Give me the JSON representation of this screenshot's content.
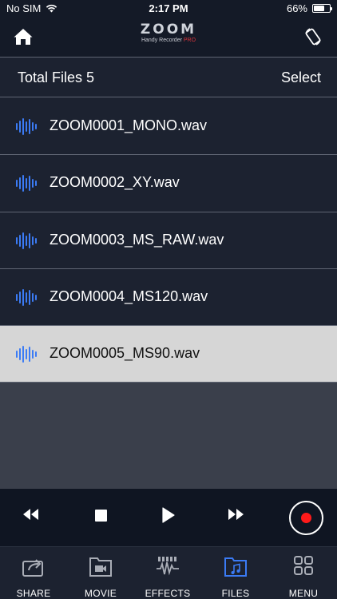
{
  "status_bar": {
    "carrier": "No SIM",
    "time": "2:17 PM",
    "battery_percent": "66%",
    "battery_level": 0.66,
    "icons": [
      "wifi-icon",
      "battery-icon"
    ]
  },
  "top_bar": {
    "logo": "ZOOM",
    "subtitle": "Handy Recorder",
    "subtitle_pro": "PRO",
    "icons": [
      "home-icon",
      "rotate-lock-icon"
    ]
  },
  "file_header": {
    "total_files": "Total Files 5",
    "select_label": "Select"
  },
  "files": [
    {
      "name": "ZOOM0001_MONO.wav",
      "selected": false
    },
    {
      "name": "ZOOM0002_XY.wav",
      "selected": false
    },
    {
      "name": "ZOOM0003_MS_RAW.wav",
      "selected": false
    },
    {
      "name": "ZOOM0004_MS120.wav",
      "selected": false
    },
    {
      "name": "ZOOM0005_MS90.wav",
      "selected": true
    }
  ],
  "transport": {
    "icons": [
      "rewind-icon",
      "stop-icon",
      "play-icon",
      "fast-forward-icon",
      "record-icon"
    ]
  },
  "tabs": [
    {
      "label": "SHARE",
      "icon": "share-icon",
      "active": false
    },
    {
      "label": "MOVIE",
      "icon": "movie-icon",
      "active": false
    },
    {
      "label": "EFFECTS",
      "icon": "effects-icon",
      "active": false
    },
    {
      "label": "FILES",
      "icon": "files-icon",
      "active": true
    },
    {
      "label": "MENU",
      "icon": "menu-icon",
      "active": false
    }
  ],
  "colors": {
    "accent_blue": "#3b7bf5",
    "record_red": "#ff1a1a",
    "pro_red": "#d9343c",
    "background": "#1c2230",
    "selected_row": "#d6d6d6"
  }
}
